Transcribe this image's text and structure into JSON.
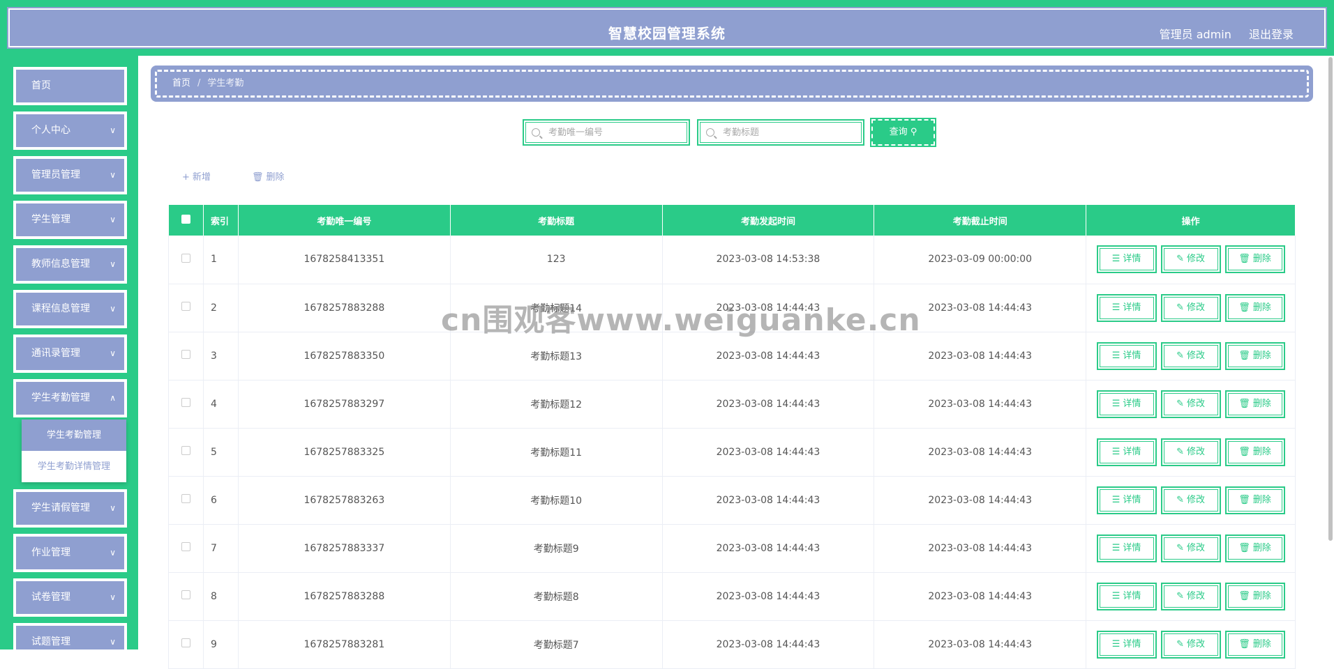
{
  "header": {
    "title": "智慧校园管理系统",
    "user": "管理员 admin",
    "logout": "退出登录"
  },
  "sidebar": {
    "items": [
      {
        "label": "首页",
        "chevron": false
      },
      {
        "label": "个人中心",
        "chevron": true
      },
      {
        "label": "管理员管理",
        "chevron": true
      },
      {
        "label": "学生管理",
        "chevron": true
      },
      {
        "label": "教师信息管理",
        "chevron": true
      },
      {
        "label": "课程信息管理",
        "chevron": true
      },
      {
        "label": "通讯录管理",
        "chevron": true
      },
      {
        "label": "学生考勤管理",
        "chevron": true,
        "expanded": true
      },
      {
        "label": "学生请假管理",
        "chevron": true
      },
      {
        "label": "作业管理",
        "chevron": true
      },
      {
        "label": "试卷管理",
        "chevron": true
      },
      {
        "label": "试题管理",
        "chevron": true
      }
    ],
    "submenu": [
      "学生考勤管理",
      "学生考勤详情管理"
    ]
  },
  "breadcrumb": {
    "home": "首页",
    "separator": "/",
    "current": "学生考勤"
  },
  "search": {
    "field1_placeholder": "考勤唯一编号",
    "field2_placeholder": "考勤标题",
    "query_label": "查询"
  },
  "actions": {
    "add": "新增",
    "delete": "删除"
  },
  "table": {
    "headers": [
      "索引",
      "考勤唯一编号",
      "考勤标题",
      "考勤发起时间",
      "考勤截止时间",
      "操作"
    ],
    "ops": [
      "详情",
      "修改",
      "删除"
    ],
    "rows": [
      [
        "1",
        "1678258413351",
        "123",
        "2023-03-08 14:53:38",
        "2023-03-09 00:00:00"
      ],
      [
        "2",
        "1678257883288",
        "考勤标题14",
        "2023-03-08 14:44:43",
        "2023-03-08 14:44:43"
      ],
      [
        "3",
        "1678257883350",
        "考勤标题13",
        "2023-03-08 14:44:43",
        "2023-03-08 14:44:43"
      ],
      [
        "4",
        "1678257883297",
        "考勤标题12",
        "2023-03-08 14:44:43",
        "2023-03-08 14:44:43"
      ],
      [
        "5",
        "1678257883325",
        "考勤标题11",
        "2023-03-08 14:44:43",
        "2023-03-08 14:44:43"
      ],
      [
        "6",
        "1678257883263",
        "考勤标题10",
        "2023-03-08 14:44:43",
        "2023-03-08 14:44:43"
      ],
      [
        "7",
        "1678257883337",
        "考勤标题9",
        "2023-03-08 14:44:43",
        "2023-03-08 14:44:43"
      ],
      [
        "8",
        "1678257883288",
        "考勤标题8",
        "2023-03-08 14:44:43",
        "2023-03-08 14:44:43"
      ],
      [
        "9",
        "1678257883281",
        "考勤标题7",
        "2023-03-08 14:44:43",
        "2023-03-08 14:44:43"
      ]
    ]
  },
  "watermark": "cn围观客www.weiguanke.cn",
  "colors": {
    "primary": "#2acb88",
    "secondary": "#8f9fd0"
  }
}
